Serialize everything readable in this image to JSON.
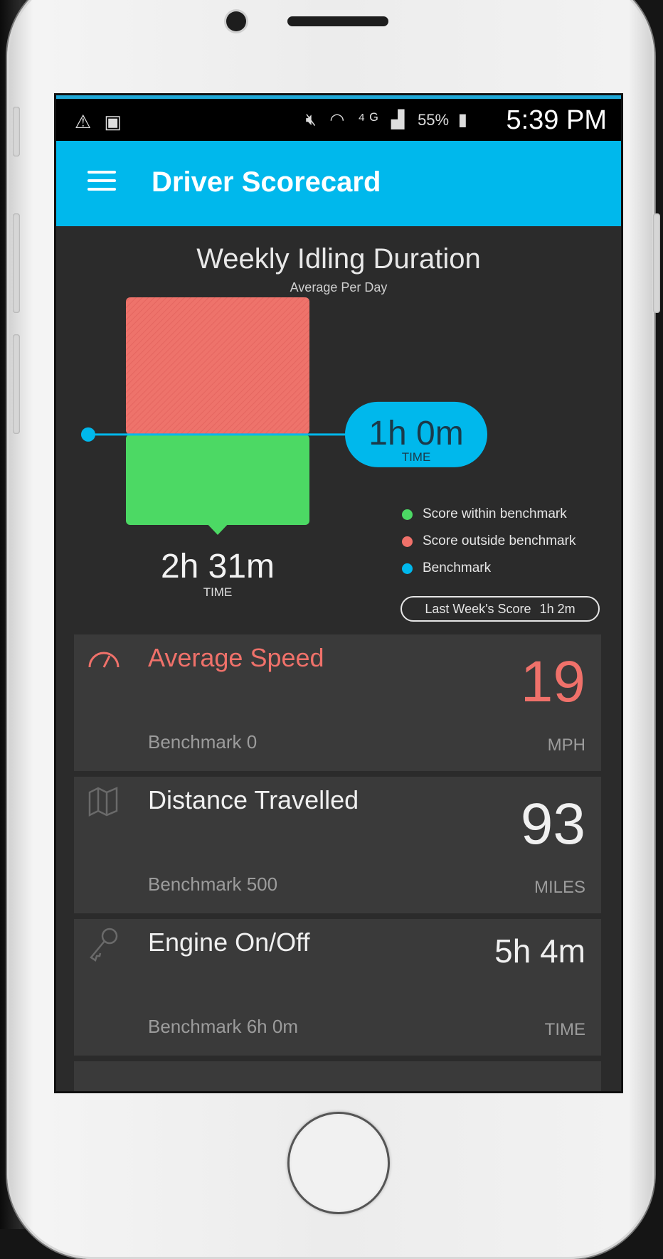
{
  "status_bar": {
    "left_icons": [
      "warning-icon",
      "image-icon"
    ],
    "right_icons": [
      "mute-icon",
      "wifi-icon",
      "lte-icon",
      "signal-icon",
      "battery-icon"
    ],
    "battery": "55%",
    "time": "5:39 PM"
  },
  "app_bar": {
    "title": "Driver Scorecard",
    "menu_icon": "hamburger-menu-icon",
    "color": "#00b8ec"
  },
  "chart": {
    "title": "Weekly Idling Duration",
    "subtitle": "Average Per Day",
    "bar_value": "2h 31m",
    "bar_unit": "TIME",
    "benchmark_value": "1h 0m",
    "benchmark_unit": "TIME",
    "legend": [
      {
        "label": "Score within benchmark",
        "color": "#4cd964"
      },
      {
        "label": "Score outside benchmark",
        "color": "#f0716a"
      },
      {
        "label": "Benchmark",
        "color": "#00b8ec"
      }
    ],
    "last_week_label": "Last Week's Score",
    "last_week_value": "1h 2m"
  },
  "chart_data": {
    "type": "bar",
    "categories": [
      ""
    ],
    "series": [
      {
        "name": "Score within benchmark",
        "values": [
          60
        ],
        "color": "#4cd964"
      },
      {
        "name": "Score outside benchmark",
        "values": [
          91
        ],
        "color": "#f0716a"
      }
    ],
    "benchmark": 60,
    "total": 151
  },
  "metrics": [
    {
      "name": "Average Speed",
      "icon": "speedometer-icon",
      "benchmark": "Benchmark 0",
      "value": "19",
      "unit": "MPH",
      "alert": true
    },
    {
      "name": "Distance Travelled",
      "icon": "map-icon",
      "benchmark": "Benchmark 500",
      "value": "93",
      "unit": "MILES",
      "alert": false
    },
    {
      "name": "Engine On/Off",
      "icon": "key-icon",
      "benchmark": "Benchmark 6h 0m",
      "value": "5h 4m",
      "unit": "TIME",
      "alert": false
    }
  ]
}
